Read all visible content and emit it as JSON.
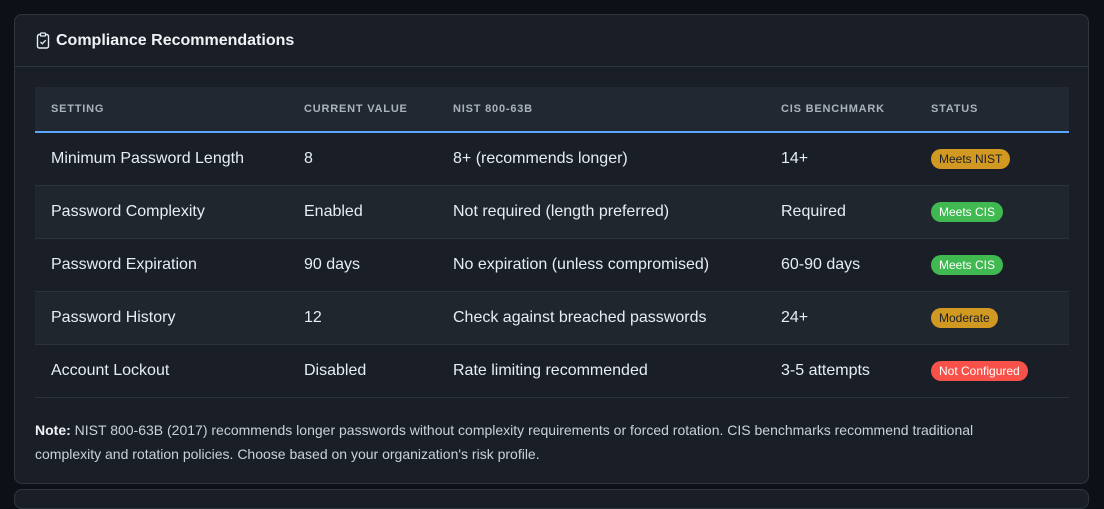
{
  "panel": {
    "icon": "clipboard-icon",
    "title": "Compliance Recommendations"
  },
  "table": {
    "headers": [
      "SETTING",
      "CURRENT VALUE",
      "NIST 800-63B",
      "CIS BENCHMARK",
      "STATUS"
    ],
    "rows": [
      {
        "setting": "Minimum Password Length",
        "current": "8",
        "nist": "8+ (recommends longer)",
        "cis": "14+",
        "status": "Meets NIST",
        "status_type": "warn"
      },
      {
        "setting": "Password Complexity",
        "current": "Enabled",
        "nist": "Not required (length preferred)",
        "cis": "Required",
        "status": "Meets CIS",
        "status_type": "ok"
      },
      {
        "setting": "Password Expiration",
        "current": "90 days",
        "nist": "No expiration (unless compromised)",
        "cis": "60-90 days",
        "status": "Meets CIS",
        "status_type": "ok"
      },
      {
        "setting": "Password History",
        "current": "12",
        "nist": "Check against breached passwords",
        "cis": "24+",
        "status": "Moderate",
        "status_type": "warn"
      },
      {
        "setting": "Account Lockout",
        "current": "Disabled",
        "nist": "Rate limiting recommended",
        "cis": "3-5 attempts",
        "status": "Not Configured",
        "status_type": "bad"
      }
    ]
  },
  "note": {
    "label": "Note:",
    "text": "NIST 800-63B (2017) recommends longer passwords without complexity requirements or forced rotation. CIS benchmarks recommend traditional complexity and rotation policies. Choose based on your organization's risk profile."
  },
  "colors": {
    "accent": "#58a6ff",
    "warn": "#d29922",
    "ok": "#3fb950",
    "bad": "#f85149"
  }
}
